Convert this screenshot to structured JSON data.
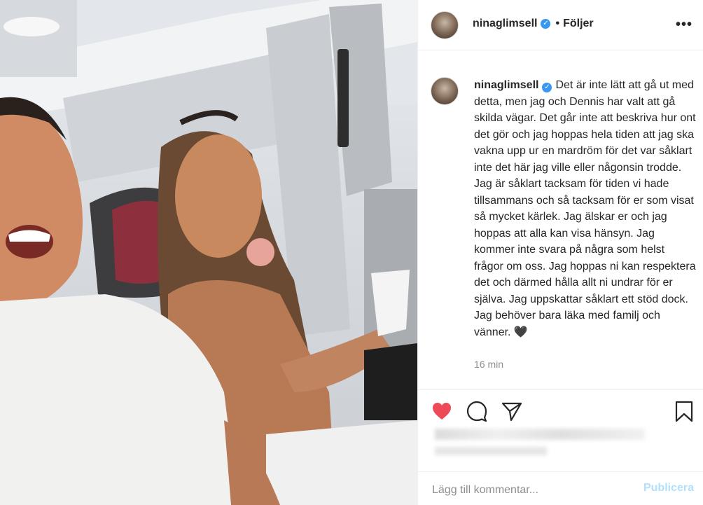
{
  "post": {
    "username": "ninaglimsell",
    "verified_glyph": "✓",
    "dot": "•",
    "follow_label": "Följer",
    "more_glyph": "•••",
    "caption_text": "Det är inte lätt att gå ut med detta, men jag och Dennis har valt att gå skilda vägar. Det går inte att beskriva hur ont det gör och jag hoppas hela tiden att jag ska vakna upp ur en mardröm för det var såklart inte det här jag ville eller någonsin trodde. Jag är såklart tacksam för tiden vi hade tillsammans och så tacksam för er som visat så mycket kärlek. Jag älskar er och jag hoppas att alla kan visa hänsyn. Jag kommer inte svara på några som helst frågor om oss. Jag hoppas ni kan respektera det och därmed hålla allt ni undrar för er själva. Jag uppskattar såklart ett stöd dock. Jag behöver bara läka med familj och vänner. 🖤",
    "time_ago": "16 min"
  },
  "actions": {
    "icons": [
      "heart-icon",
      "comment-icon",
      "share-icon",
      "bookmark-icon"
    ],
    "like_color": "#ed4956"
  },
  "comment": {
    "placeholder": "Lägg till kommentar...",
    "publish_label": "Publicera",
    "publish_color": "#b2dffc"
  },
  "colors": {
    "verified": "#3897f0",
    "muted": "#8e8e8e",
    "text": "#262626"
  }
}
